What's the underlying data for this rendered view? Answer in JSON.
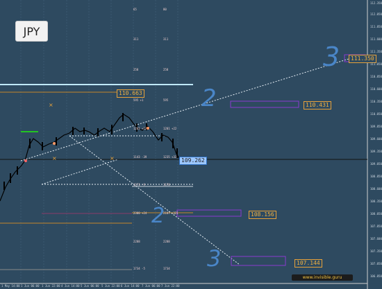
{
  "symbol": "JPY",
  "levels": {
    "upper_target": "111.350",
    "current_price": "109.262",
    "level_a": "110.663",
    "level_b": "110.431",
    "level_c": "108.156",
    "level_d": "107.144"
  },
  "wave_labels": [
    "3",
    "2",
    "2",
    "3"
  ],
  "footer_text": "www.invisible.guru",
  "y_axis_ticks": [
    "112.350",
    "112.050",
    "111.850",
    "111.600",
    "111.350",
    "111.050",
    "110.850",
    "110.600",
    "110.350",
    "110.050",
    "109.850",
    "109.600",
    "109.350",
    "109.050",
    "108.850",
    "108.600",
    "108.350",
    "108.050",
    "107.850",
    "107.600",
    "107.350",
    "107.050",
    "106.850"
  ],
  "x_axis_ticks": [
    "1 May 14:00",
    "1 Jun 06:00",
    "1 Jun 22:00",
    "4 Jun 14:00",
    "5 Jun 06:00",
    "5 Jun 22:00",
    "6 Jun 14:00",
    "7 Jun 06:00",
    "7 Jun 22:00"
  ],
  "volume_labels_left": [
    "65",
    "311",
    "258",
    "595 +1",
    "1201 +22",
    "1143 -39",
    "1171 -9",
    "2300 +24",
    "2288",
    "1734 -5"
  ],
  "volume_labels_right": [
    "80",
    "311",
    "258",
    "595",
    "1201 +22",
    "1235 +33",
    "1178",
    "2187 +321",
    "2288",
    "1734"
  ],
  "colors": {
    "background": "#2e4a60",
    "accent": "#e8a23a",
    "grid": "#3b5870"
  }
}
